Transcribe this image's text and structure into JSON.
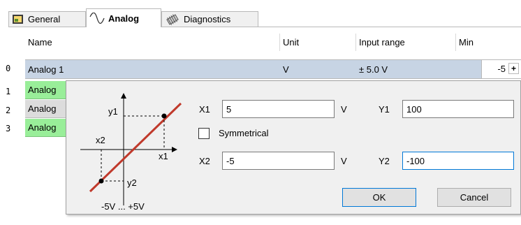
{
  "tabs": [
    {
      "label": "General",
      "icon": "general-icon"
    },
    {
      "label": "Analog",
      "icon": "analog-wave-icon"
    },
    {
      "label": "Diagnostics",
      "icon": "diagnostics-chip-icon"
    }
  ],
  "grid": {
    "headers": {
      "name": "Name",
      "unit": "Unit",
      "input_range": "Input range",
      "min": "Min"
    },
    "rows": [
      {
        "index": "0",
        "name": "Analog 1",
        "unit": "V",
        "input_range": "± 5.0 V",
        "min": "-5"
      },
      {
        "index": "1",
        "name": "Analog"
      },
      {
        "index": "2",
        "name": "Analog"
      },
      {
        "index": "3",
        "name": "Analog"
      }
    ],
    "min_button_glyph": "+"
  },
  "dialog": {
    "diagram": {
      "y1": "y1",
      "x2": "x2",
      "x1": "x1",
      "y2": "y2",
      "range_caption": "-5V ... +5V"
    },
    "x1_label": "X1",
    "x1_value": "5",
    "x1_unit": "V",
    "y1_label": "Y1",
    "y1_value": "100",
    "symmetrical_label": "Symmetrical",
    "symmetrical_checked": false,
    "x2_label": "X2",
    "x2_value": "-5",
    "x2_unit": "V",
    "y2_label": "Y2",
    "y2_value": "-100",
    "ok_label": "OK",
    "cancel_label": "Cancel"
  },
  "colors": {
    "selected_row": "#c7d4e4",
    "green_row": "#99ee99",
    "line": "#c0392b",
    "focus": "#0078d7"
  }
}
